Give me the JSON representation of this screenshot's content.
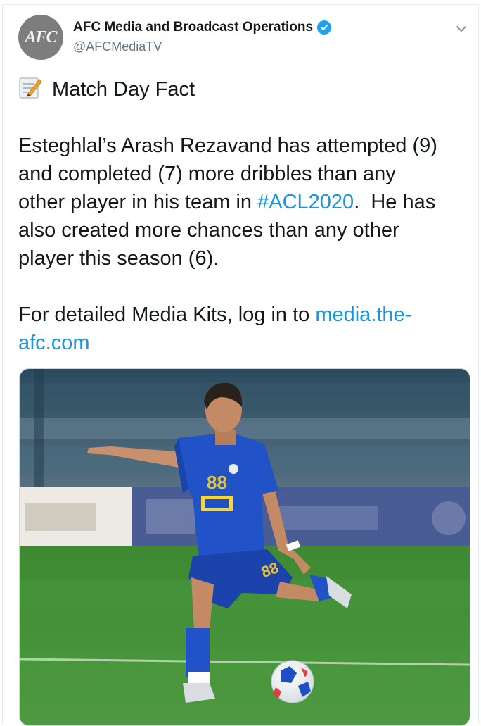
{
  "tweet": {
    "display_name": "AFC Media and Broadcast Operations",
    "handle": "@AFCMediaTV",
    "avatar_text": "AFC",
    "heading": "Match Day Fact",
    "body_lines": [
      "Esteghlal’s Arash Rezavand has attempted (9)",
      "and completed (7) more dribbles than any",
      "player this season (6)."
    ],
    "line3_prefix": "other player in his team in ",
    "hashtag": "#ACL2020",
    "line3_suffix": ".  He has",
    "line4": "also created more chances than any other",
    "media_prefix": "For detailed Media Kits, log in to ",
    "media_link_part1": "media.the-",
    "media_link_part2": "afc.com",
    "shirt_number": "88"
  },
  "icons": {
    "verified": "verified-badge-icon",
    "caret": "chevron-down-icon",
    "memo": "memo-emoji-icon"
  },
  "colors": {
    "link": "#1b95e0",
    "verified": "#1da1f2",
    "kit_blue": "#1f4fc4",
    "pitch": "#3f8a35"
  }
}
